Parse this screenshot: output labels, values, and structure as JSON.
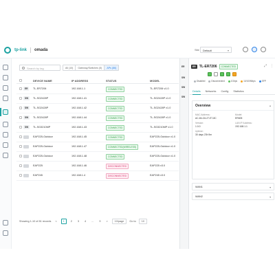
{
  "header": {
    "brand": "tp-link",
    "product": "omada",
    "site_label": "Site",
    "site_value": "Default"
  },
  "toolbar": {
    "search_placeholder": "Search by tag",
    "filters": [
      "All (10)",
      "Gateway/Switches (5)",
      "APs (86)"
    ]
  },
  "table": {
    "columns": [
      "DEVICE NAME",
      "IP ADDRESS",
      "STATUS",
      "MODEL"
    ],
    "rows": [
      {
        "tag": "ER",
        "name": "TL-ER7206",
        "ip": "192.168.1.1",
        "status": "CONNECTED",
        "model": "TL-ER7206 v1.0",
        "ok": true
      },
      {
        "tag": "SW",
        "name": "TL-SG2428P",
        "ip": "192.168.1.41",
        "status": "CONNECTED",
        "model": "TL-SG2428P v1.0",
        "ok": true
      },
      {
        "tag": "SW",
        "name": "TL-SG2428P",
        "ip": "192.168.1.42",
        "status": "CONNECTED",
        "model": "TL-SG2428P v1.0",
        "ok": true
      },
      {
        "tag": "SW",
        "name": "TL-SG2428P",
        "ip": "192.168.1.44",
        "status": "CONNECTED",
        "model": "TL-SG2428P v1.0",
        "ok": true
      },
      {
        "tag": "SW",
        "name": "TL-SG3210MP",
        "ip": "192.168.1.43",
        "status": "CONNECTED",
        "model": "TL-SG3210MP v1.0",
        "ok": true
      },
      {
        "tag": "",
        "name": "EAP225-Outdoor",
        "ip": "192.168.1.45",
        "status": "CONNECTED",
        "model": "EAP225-Outdoor v1.0",
        "ok": true
      },
      {
        "tag": "",
        "name": "EAP225-Outdoor",
        "ip": "192.168.1.47",
        "status": "CONNECTED(WIRELESS)",
        "model": "EAP225-Outdoor v1.0",
        "ok": true
      },
      {
        "tag": "",
        "name": "EAP225-Outdoor",
        "ip": "192.168.1.48",
        "status": "CONNECTED",
        "model": "EAP225-Outdoor v1.0",
        "ok": true
      },
      {
        "tag": "",
        "name": "EAP225",
        "ip": "192.168.1.46",
        "status": "DISCONNECTED",
        "model": "EAP225 v3.0",
        "ok": false
      },
      {
        "tag": "",
        "name": "EAP245",
        "ip": "192.168.1.4",
        "status": "DISCONNECTED",
        "model": "EAP245 v3.0",
        "ok": false
      }
    ]
  },
  "pagination": {
    "summary": "Showing 1-10 of 81 records",
    "prev": "<",
    "pages": [
      "1",
      "2",
      "3",
      "4",
      "...",
      "9"
    ],
    "next": ">",
    "per_page": "10/page",
    "goto_label": "Go to",
    "goto_value": "10"
  },
  "panel": {
    "side_tabs": [
      "ER",
      "SW",
      "SW",
      "SW"
    ],
    "device_tag": "ER",
    "device_name": "TL-ER7206",
    "device_status": "CONNECTED",
    "legend": [
      {
        "label": "Disabled",
        "color": "#b0b5bb"
      },
      {
        "label": "Disconnected",
        "color": "#b0b5bb"
      },
      {
        "label": "1Gbps",
        "color": "#5cc35c"
      },
      {
        "label": "10/100Mbps",
        "color": "#f5a623"
      },
      {
        "label": "SFP",
        "color": "#2e82e6"
      }
    ],
    "tabs": [
      "Details",
      "Networks",
      "Config",
      "Statistics"
    ],
    "overview_title": "Overview",
    "overview": [
      {
        "k": "MAC Address:",
        "v": "AC-84-C6-27-E7-8C"
      },
      {
        "k": "Model:",
        "v": "ER605"
      },
      {
        "k": "Version:",
        "v": "1.0.0"
      },
      {
        "k": "LAN IP Address:",
        "v": "192.168.1.1"
      },
      {
        "k": "Uptime:",
        "v": "30 days 23h 9m"
      }
    ],
    "sections": [
      "WAN1",
      "WAN2"
    ]
  }
}
